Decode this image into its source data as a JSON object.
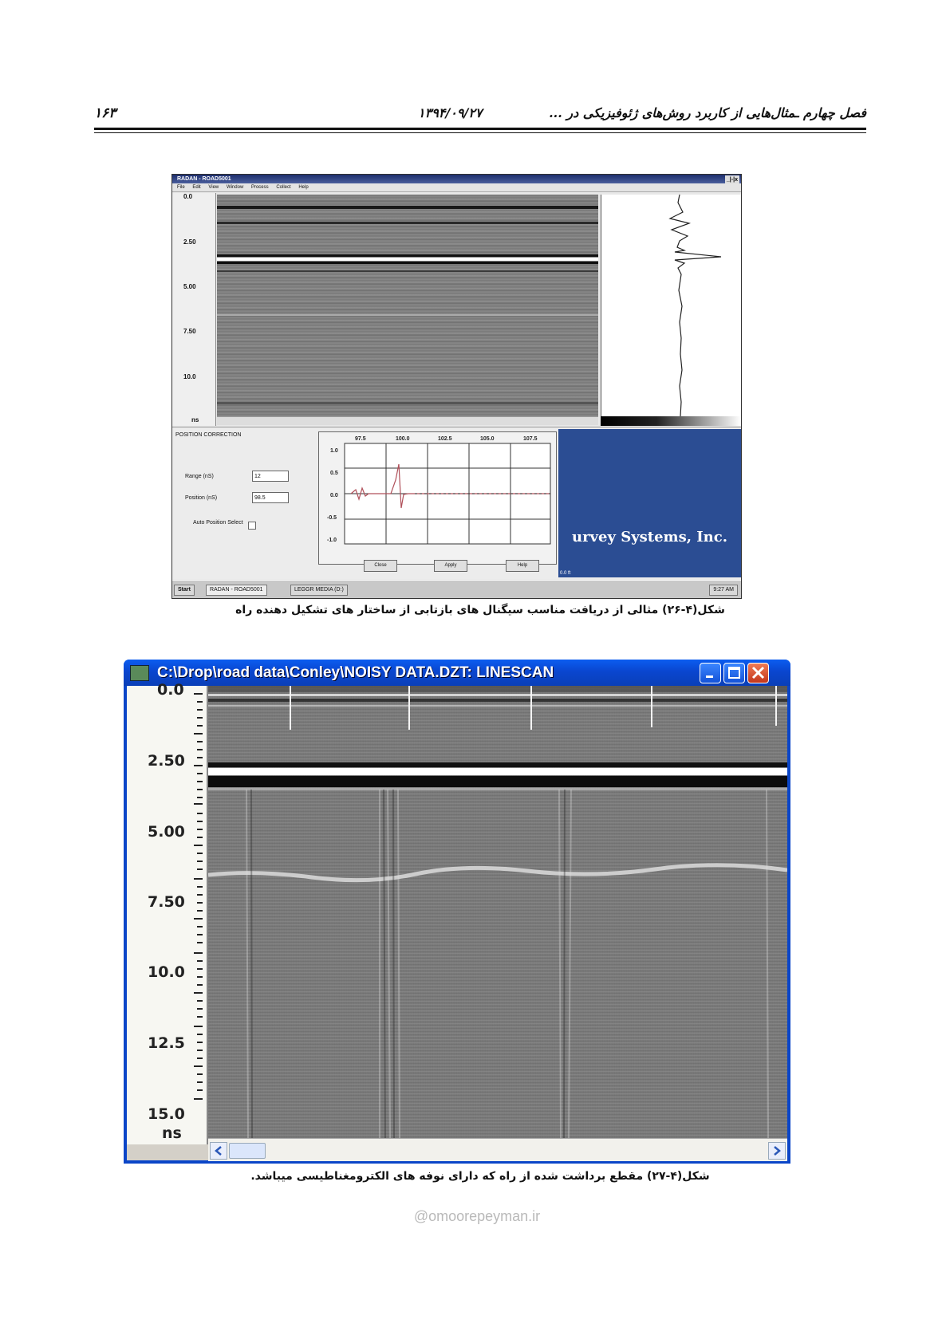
{
  "header": {
    "page_number": "۱۶۳",
    "date": "۱۳۹۴/۰۹/۲۷",
    "chapter_title": "فصل چهارم  ـمثال‌هایی از کاربرد روش‌های ژئوفیزیکی در ..."
  },
  "figure26": {
    "window_title": "RADAN - ROAD5001",
    "window_buttons": "_|▫|x",
    "menu": [
      "File",
      "Edit",
      "View",
      "Window",
      "Process",
      "Collect",
      "Help"
    ],
    "depth_axis": {
      "ticks": [
        "0.0",
        "2.50",
        "5.00",
        "7.50",
        "10.0"
      ],
      "unit": "ns"
    },
    "panel": {
      "title": "POSITION CORRECTION",
      "range_label": "Range (nS)",
      "range_value": "12",
      "position_label": "Position (nS)",
      "position_value": "98.5",
      "auto_label": "Auto Position Select"
    },
    "plot": {
      "x_ticks": [
        "97.5",
        "100.0",
        "102.5",
        "105.0",
        "107.5"
      ],
      "y_ticks": [
        "1.0",
        "0.5",
        "0.0",
        "-0.5",
        "-1.0"
      ]
    },
    "buttons": {
      "close": "Close",
      "apply": "Apply",
      "help": "Help"
    },
    "logo_text": "urvey Systems, Inc.",
    "status_text": "0.0 ft",
    "taskbar": {
      "start": "Start",
      "task1": "RADAN - ROAD5001",
      "task2": "LEGGR MEDIA (D:)",
      "clock": "9:27 AM"
    },
    "caption": "شکل(۴-۲۶)  مثالی از دریافت مناسب سیگنال های بازتابی از ساختار های تشکیل دهنده راه"
  },
  "figure27": {
    "window_title": "C:\\Drop\\road data\\Conley\\NOISY DATA.DZT:  LINESCAN",
    "depth_axis": {
      "ticks": [
        "0.0",
        "2.50",
        "5.00",
        "7.50",
        "10.0",
        "12.5",
        "15.0"
      ],
      "unit": "ns"
    },
    "caption": "شکل(۴-۲۷)  مقطع برداشت شده از راه که دارای نوفه های الکترومغناطیسی میباشد."
  },
  "watermark_text": "@omoorepeyman.ir",
  "colors": {
    "xp_title_blue": "#0a46cf",
    "close_red": "#c4361b",
    "logo_blue": "#2b4d93"
  }
}
